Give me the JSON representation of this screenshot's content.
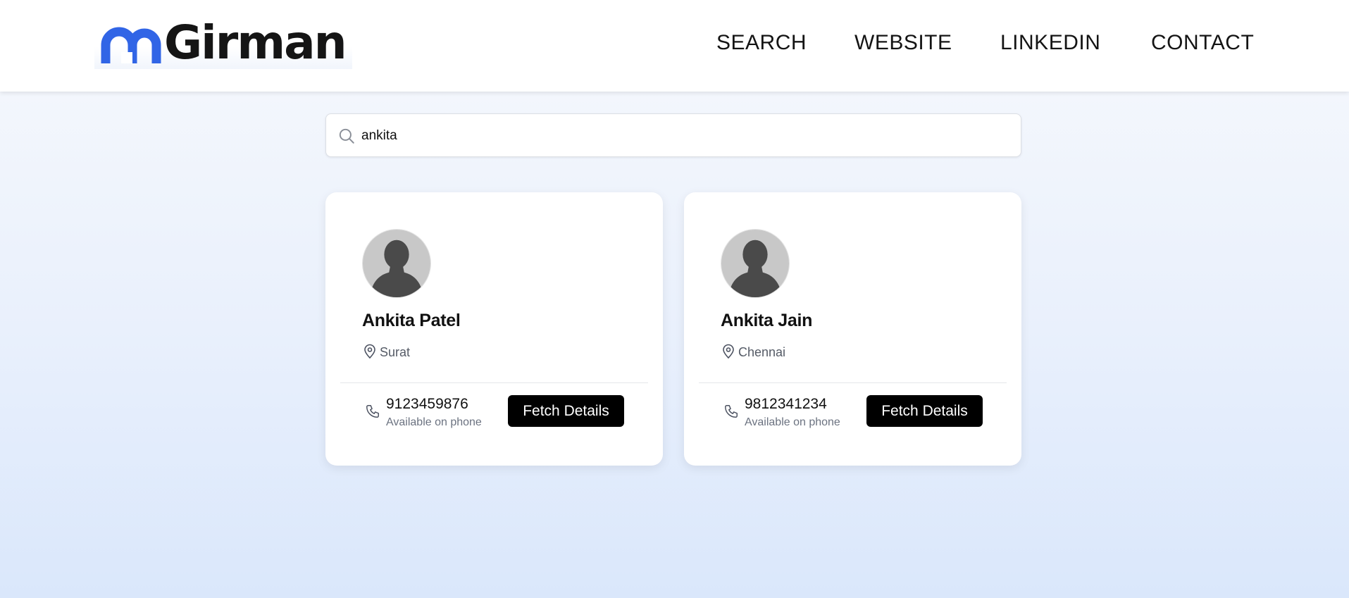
{
  "brand": {
    "name": "Girman",
    "accent": "#3165e6"
  },
  "nav": {
    "items": [
      {
        "label": "SEARCH"
      },
      {
        "label": "WEBSITE"
      },
      {
        "label": "LINKEDIN"
      },
      {
        "label": "CONTACT"
      }
    ]
  },
  "search": {
    "value": "ankita",
    "icon": "search-icon"
  },
  "results": [
    {
      "name": "Ankita Patel",
      "location": "Surat",
      "phone": "9123459876",
      "phone_note": "Available on phone",
      "button": "Fetch Details"
    },
    {
      "name": "Ankita Jain",
      "location": "Chennai",
      "phone": "9812341234",
      "phone_note": "Available on phone",
      "button": "Fetch Details"
    }
  ]
}
